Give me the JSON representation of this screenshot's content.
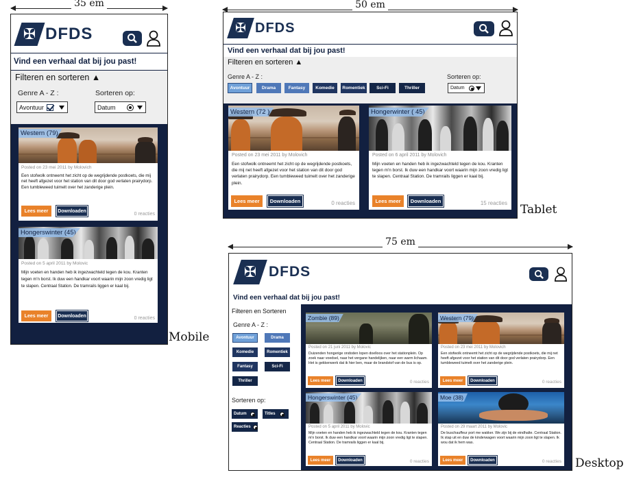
{
  "brand": {
    "logo_text": "DFDS",
    "logo_mark": "✠"
  },
  "dimensions": {
    "mobile": "35 em",
    "tablet": "50 em",
    "desktop": "75 em"
  },
  "device_labels": {
    "mobile": "Mobile",
    "tablet": "Tablet",
    "desktop": "Desktop"
  },
  "tagline": "Vind een verhaal dat bij jou past!",
  "filter": {
    "title_sort": "Filteren en sorteren ▲",
    "title_plain": "Filteren en Sorteren",
    "genre_label": "Genre  A - Z :",
    "sort_label": "Sorteren op:",
    "genre_value": "Avontuur",
    "sort_value": "Datum",
    "genres": [
      "Avontuur",
      "Drama",
      "Fantasy",
      "Komedie",
      "Romentiek",
      "Sci-Fi",
      "Thriller"
    ],
    "sort_options": [
      "Datum",
      "Titles",
      "Reacties"
    ]
  },
  "buttons": {
    "read_more": "Lees meer",
    "download": "Downloaden"
  },
  "posts": {
    "western": {
      "category": "Western (79)",
      "category_tablet": "Western (72 )",
      "meta": "Posted on 23 mei 2011 by Molovich",
      "body": "Een stofwolk ontneemt het zicht op de wegrijdende postkoets, die mij net heeft afgezet voor het station van dit door god verlaten prairydorp. Een tumbleweed tuimelt over het zanderige plein.",
      "reactions": "0 reacties"
    },
    "hongerwinter": {
      "category": "Hongerswinter (45)",
      "category_tablet": "Hongerwinter (  45)",
      "meta": "Posted on 5  april 2011 by Molovic",
      "meta_tablet": "Posted on 6 april 2011 by Molovich",
      "body": "Mijn voeten en handen heb ik ingezwachteld tegen de kou. Kranten tegen m'n borst. Ik duw een handkar voort waarin mijn zoon vredig ligt te slapen. Centraal Station. De tramrails liggen er kaal bij.",
      "reactions": "0 reacties",
      "reactions_tablet": "15 reacties"
    },
    "zombie": {
      "category": "Zombie (89)",
      "meta": "Posted on 21 juni 2011 by Molovic",
      "body": "Duizenden hongerige ondoden lopen doelloos over het stationplein. Op zoek naar voedsel, naar het vergane handelijken, naar een warm lichaam. Het is gekkenwerk dat ik hier ben, maar de brandstof van de bus is op.",
      "reactions": "0 reacties"
    },
    "moe": {
      "category": "Moe (38)",
      "meta": "Posted on 29 maart 2011 by Molovic",
      "body": "De buschauffeur port me wakker. We zijn bij de eindhalte. Centraal Station. Ik stap uit en duw de kinderwagen voort waarin mijn zoon ligt te slapen. Ik wou dat ik hem was.",
      "reactions": "0 reacties"
    }
  }
}
